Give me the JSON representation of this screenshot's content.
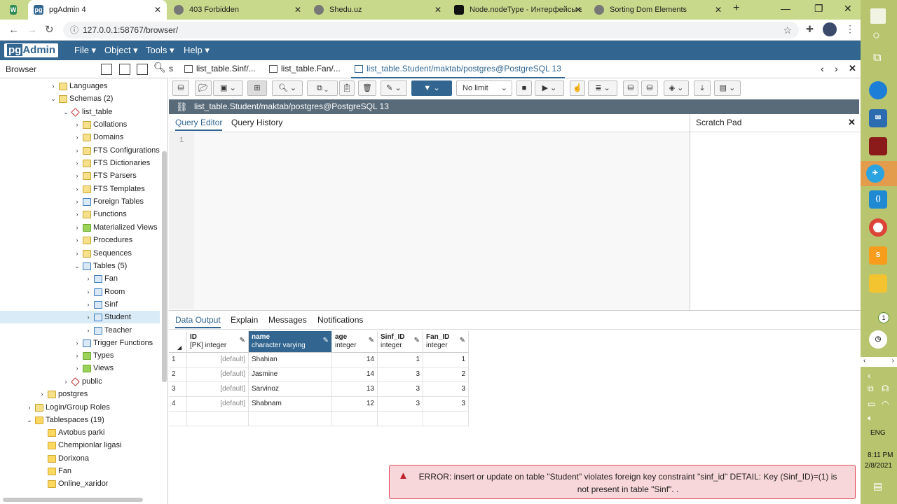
{
  "chrome": {
    "tabs": [
      {
        "title": "pgAdmin 4",
        "active": true
      },
      {
        "title": "403 Forbidden"
      },
      {
        "title": "Shedu.uz"
      },
      {
        "title": "Node.nodeType - Интерфейсы в"
      },
      {
        "title": "Sorting Dom Elements"
      }
    ],
    "new_tab": "+",
    "url": "127.0.0.1:58767/browser/"
  },
  "pgadmin": {
    "logo_pg": "pg",
    "logo_admin": "Admin",
    "menus": [
      "File ▾",
      "Object ▾",
      "Tools ▾",
      "Help ▾"
    ]
  },
  "browser": {
    "title": "Browser",
    "tree": [
      "Languages",
      "Schemas (2)",
      "list_table",
      "Collations",
      "Domains",
      "FTS Configurations",
      "FTS Dictionaries",
      "FTS Parsers",
      "FTS Templates",
      "Foreign Tables",
      "Functions",
      "Materialized Views",
      "Procedures",
      "Sequences",
      "Tables (5)",
      "Fan",
      "Room",
      "Sinf",
      "Student",
      "Teacher",
      "Trigger Functions",
      "Types",
      "Views",
      "public",
      "postgres",
      "Login/Group Roles",
      "Tablespaces (19)",
      "Avtobus parki",
      "Chempionlar ligasi",
      "Dorixona",
      "Fan",
      "Online_xaridor"
    ]
  },
  "query_tabs": [
    "s",
    "list_table.Sinf/...",
    "list_table.Fan/...",
    "list_table.Student/maktab/postgres@PostgreSQL 13"
  ],
  "toolbar": {
    "limit": "No limit"
  },
  "connection": "list_table.Student/maktab/postgres@PostgreSQL 13",
  "editor_tabs": {
    "query_editor": "Query Editor",
    "query_history": "Query History",
    "scratch_pad": "Scratch Pad",
    "line": "1"
  },
  "output_tabs": [
    "Data Output",
    "Explain",
    "Messages",
    "Notifications"
  ],
  "grid": {
    "columns": [
      {
        "name": "ID",
        "type": "[PK] integer"
      },
      {
        "name": "name",
        "type": "character varying"
      },
      {
        "name": "age",
        "type": "integer"
      },
      {
        "name": "Sinf_ID",
        "type": "integer"
      },
      {
        "name": "Fan_ID",
        "type": "integer"
      }
    ],
    "rows": [
      {
        "n": "1",
        "id": "[default]",
        "name": "Shahian",
        "age": "14",
        "sinf": "1",
        "fan": "1"
      },
      {
        "n": "2",
        "id": "[default]",
        "name": "Jasmine",
        "age": "14",
        "sinf": "3",
        "fan": "2"
      },
      {
        "n": "3",
        "id": "[default]",
        "name": "Sarvinoz",
        "age": "13",
        "sinf": "3",
        "fan": "3"
      },
      {
        "n": "4",
        "id": "[default]",
        "name": "Shabnam",
        "age": "12",
        "sinf": "3",
        "fan": "3"
      }
    ]
  },
  "error": "ERROR: insert or update on table \"Student\" violates foreign key constraint \"sinf_id\" DETAIL: Key (Sinf_ID)=(1) is not present in table \"Sinf\". .",
  "taskbar": {
    "lang": "ENG",
    "time": "8:11 PM",
    "date": "2/8/2021",
    "badge": "1"
  }
}
